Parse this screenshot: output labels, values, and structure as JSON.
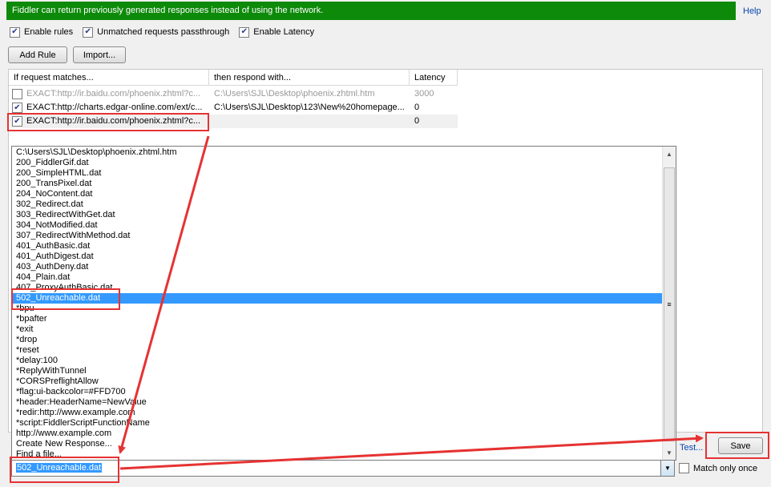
{
  "banner": {
    "text": "Fiddler can return previously generated responses instead of using the network.",
    "help": "Help"
  },
  "options": [
    {
      "label": "Enable rules",
      "checked": true
    },
    {
      "label": "Unmatched requests passthrough",
      "checked": true
    },
    {
      "label": "Enable Latency",
      "checked": true
    }
  ],
  "buttons": {
    "add_rule": "Add Rule",
    "import": "Import...",
    "save": "Save",
    "test": "Test..."
  },
  "columns": [
    "If request matches...",
    "then respond with...",
    "Latency"
  ],
  "rules": [
    {
      "match": "EXACT:http://ir.baidu.com/phoenix.zhtml?c...",
      "respond": "C:\\Users\\SJL\\Desktop\\phoenix.zhtml.htm",
      "latency": "3000",
      "enabled": false
    },
    {
      "match": "EXACT:http://charts.edgar-online.com/ext/c...",
      "respond": "C:\\Users\\SJL\\Desktop\\123\\New%20homepage...",
      "latency": "0",
      "enabled": true
    },
    {
      "match": "EXACT:http://ir.baidu.com/phoenix.zhtml?c...",
      "respond": "",
      "latency": "0",
      "enabled": true
    }
  ],
  "dropdown": {
    "items": [
      "C:\\Users\\SJL\\Desktop\\phoenix.zhtml.htm",
      "200_FiddlerGif.dat",
      "200_SimpleHTML.dat",
      "200_TransPixel.dat",
      "204_NoContent.dat",
      "302_Redirect.dat",
      "303_RedirectWithGet.dat",
      "304_NotModified.dat",
      "307_RedirectWithMethod.dat",
      "401_AuthBasic.dat",
      "401_AuthDigest.dat",
      "403_AuthDeny.dat",
      "404_Plain.dat",
      "407_ProxyAuthBasic.dat",
      "502_Unreachable.dat",
      "*bpu",
      "*bpafter",
      "*exit",
      "*drop",
      "*reset",
      "*delay:100",
      "*ReplyWithTunnel",
      "*CORSPreflightAllow",
      "*flag:ui-backcolor=#FFD700",
      "*header:HeaderName=NewValue",
      "*redir:http://www.example.com",
      "*script:FiddlerScriptFunctionName",
      "http://www.example.com",
      "Create New Response...",
      "Find a file..."
    ],
    "selected_index": 14,
    "scroll_grip": "≡"
  },
  "combo": {
    "value": "502_Unreachable.dat"
  },
  "match_only_once": {
    "label": "Match only once",
    "checked": false
  },
  "colors": {
    "banner": "#0d8a0a",
    "selection": "#3399ff",
    "annotation": "#e63232"
  }
}
